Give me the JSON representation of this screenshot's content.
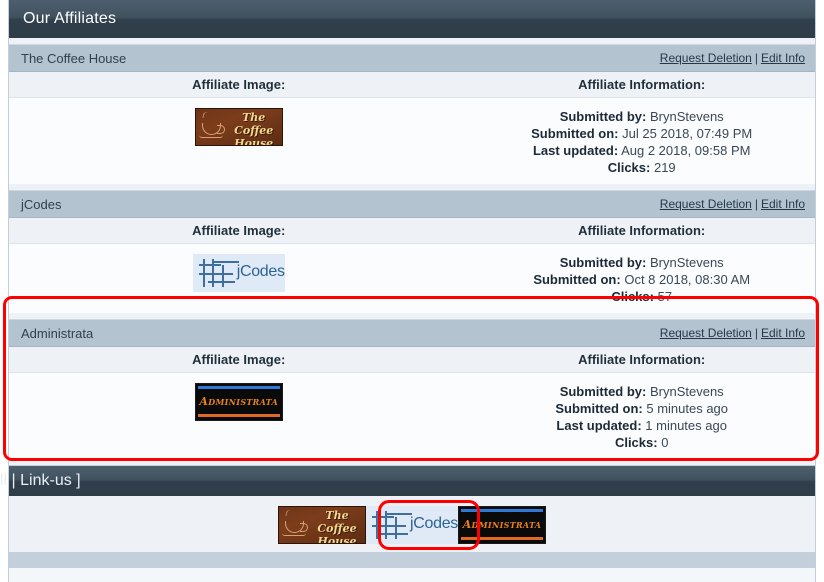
{
  "main_panel": {
    "title": "Our Affiliates",
    "column_headers": {
      "image": "Affiliate Image:",
      "info": "Affiliate Information:"
    },
    "actions": {
      "request_deletion": "Request Deletion",
      "separator": "|",
      "edit_info": "Edit Info"
    },
    "field_labels": {
      "submitted_by": "Submitted by:",
      "submitted_on": "Submitted on:",
      "last_updated": "Last updated:",
      "clicks": "Clicks:"
    },
    "affiliates": [
      {
        "name": "The Coffee House",
        "logo": "coffee-house-logo",
        "logo_text_line1": "The Coffee",
        "logo_text_line2": "House",
        "submitted_by": "BrynStevens",
        "submitted_on": "Jul 25 2018, 07:49 PM",
        "last_updated": "Aug 2 2018, 09:58 PM",
        "clicks": "219"
      },
      {
        "name": "jCodes",
        "logo": "jcodes-logo",
        "logo_text": "jCodes",
        "submitted_by": "BrynStevens",
        "submitted_on": "Oct 8 2018, 08:30 AM",
        "last_updated": null,
        "clicks": "57"
      },
      {
        "name": "Administrata",
        "logo": "administrata-logo",
        "logo_text": "Administrata",
        "submitted_by": "BrynStevens",
        "submitted_on": "5 minutes ago",
        "last_updated": "1 minutes ago",
        "clicks": "0"
      }
    ]
  },
  "footer_panel": {
    "title": "ll | Link-us ]",
    "logos": [
      {
        "name": "coffee-house-logo",
        "line1": "The Coffee",
        "line2": "House"
      },
      {
        "name": "jcodes-logo",
        "text": "jCodes"
      },
      {
        "name": "administrata-logo",
        "text": "Administrata"
      }
    ]
  },
  "annotations": {
    "color": "#ff0000",
    "highlighted_section": "Administrata",
    "highlighted_logo": "administrata-logo"
  }
}
